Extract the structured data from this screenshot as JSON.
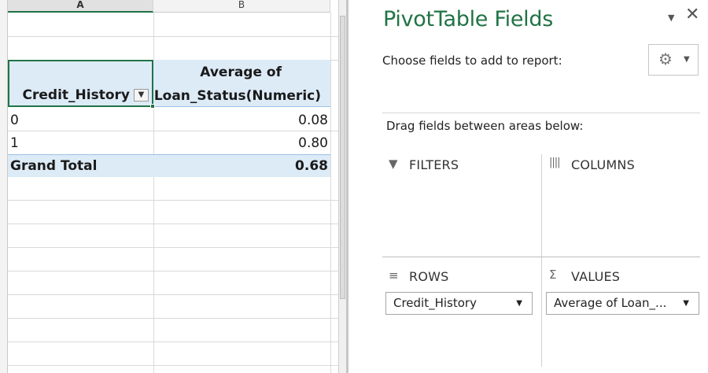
{
  "sheet": {
    "columns": [
      "A",
      "B"
    ],
    "pivot": {
      "row_header": "Credit_History",
      "value_header_line1": "Average of",
      "value_header_line2": "Loan_Status(Numeric)",
      "filter_icon": "filter-dropdown-icon",
      "rows": [
        {
          "label": "0",
          "value": "0.08"
        },
        {
          "label": "1",
          "value": "0.80"
        }
      ],
      "total": {
        "label": "Grand Total",
        "value": "0.68"
      }
    }
  },
  "pane": {
    "title": "PivotTable Fields",
    "menu_icon": "chevron-down-icon",
    "close_icon": "close-icon",
    "choose_label": "Choose fields to add to report:",
    "gear_icon": "gear-icon",
    "drag_label": "Drag fields between areas below:",
    "areas": {
      "filters": {
        "label": "FILTERS",
        "icon": "filter-icon"
      },
      "columns": {
        "label": "COLUMNS",
        "icon": "columns-icon"
      },
      "rows": {
        "label": "ROWS",
        "icon": "rows-icon",
        "field": "Credit_History"
      },
      "values": {
        "label": "VALUES",
        "icon": "sigma-icon",
        "field": "Average of Loan_..."
      }
    }
  },
  "colors": {
    "accent": "#217346",
    "pivot_header_fill": "#ddebf7",
    "pivot_border": "#9bc2e6"
  }
}
